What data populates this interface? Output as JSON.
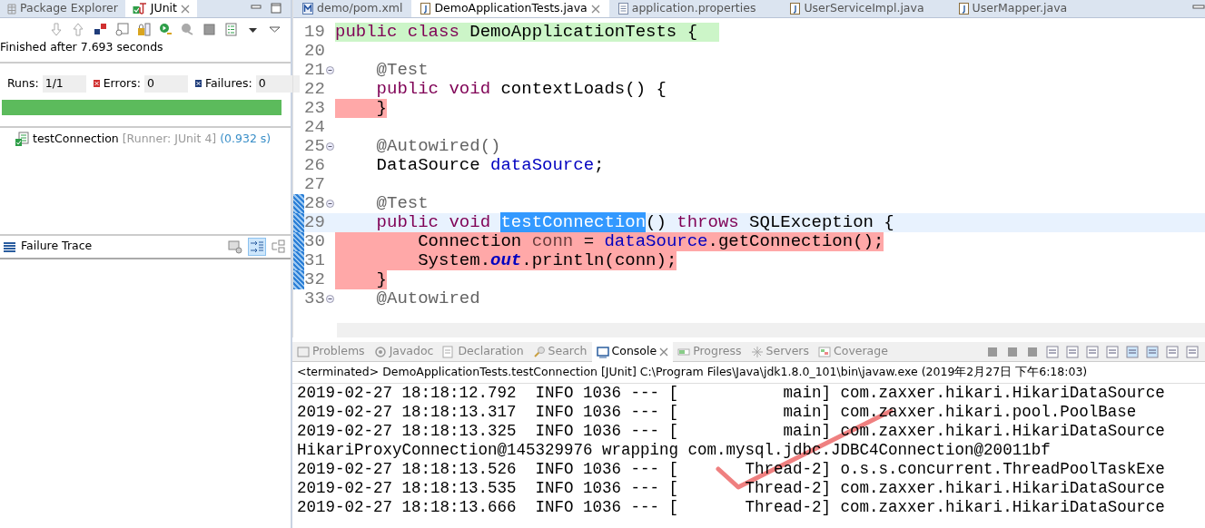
{
  "junit_view": {
    "tabs": [
      {
        "label": "Package Explorer",
        "selected": false,
        "kind": "explorer"
      },
      {
        "label": "JUnit",
        "selected": true,
        "kind": "junit"
      }
    ],
    "status": "Finished after 7.693 seconds",
    "counters": [
      {
        "label": "Runs:",
        "value": "1/1",
        "kind": "runs"
      },
      {
        "label": "Errors:",
        "value": "0",
        "kind": "errors"
      },
      {
        "label": "Failures:",
        "value": "0",
        "kind": "failures"
      }
    ],
    "progress": {
      "level": 1,
      "passed": true
    },
    "tests": [
      {
        "name": "testConnection",
        "runner": "[Runner: JUnit 4]",
        "time": "(0.932 s)",
        "passed": true
      }
    ],
    "failure_trace": {
      "title": "Failure Trace"
    }
  },
  "editor": {
    "tabs": [
      {
        "label": "demo/pom.xml",
        "selected": false,
        "kind": "xml"
      },
      {
        "label": "DemoApplicationTests.java",
        "selected": true,
        "kind": "java"
      },
      {
        "label": "application.properties",
        "selected": false,
        "kind": "text"
      },
      {
        "label": "UserServiceImpl.java",
        "selected": false,
        "kind": "java"
      },
      {
        "label": "UserMapper.java",
        "selected": false,
        "kind": "java"
      }
    ],
    "lines": [
      {
        "number": "19",
        "fold": false,
        "marked": false,
        "current": false,
        "color": "#ccf5c8",
        "tokens": [
          {
            "text": "public class",
            "kind": "keyword"
          },
          {
            "text": " DemoApplicationTests {",
            "kind": "plain"
          }
        ]
      },
      {
        "number": "20",
        "fold": false,
        "marked": false,
        "current": false
      },
      {
        "number": "21",
        "fold": true,
        "marked": false,
        "current": false,
        "tokens": [
          {
            "text": "\t@Test",
            "kind": "annotation"
          }
        ]
      },
      {
        "number": "22",
        "fold": false,
        "marked": false,
        "current": false,
        "tokens": [
          {
            "text": "\tpublic void",
            "kind": "keyword"
          },
          {
            "text": " contextLoads() {",
            "kind": "plain"
          }
        ]
      },
      {
        "number": "23",
        "fold": false,
        "marked": false,
        "current": false,
        "color": "#ffa8a8",
        "tokens": [
          {
            "text": "\t}",
            "kind": "plain"
          }
        ]
      },
      {
        "number": "24",
        "fold": false,
        "marked": false,
        "current": false
      },
      {
        "number": "25",
        "fold": true,
        "marked": false,
        "current": false,
        "tokens": [
          {
            "text": "\t@Autowired()",
            "kind": "annotation"
          }
        ]
      },
      {
        "number": "26",
        "fold": false,
        "marked": false,
        "current": false,
        "tokens": [
          {
            "text": "\tDataSource ",
            "kind": "plain"
          },
          {
            "text": "dataSource",
            "kind": "field"
          },
          {
            "text": ";",
            "kind": "plain"
          }
        ]
      },
      {
        "number": "27",
        "fold": false,
        "marked": false,
        "current": false
      },
      {
        "number": "28",
        "fold": true,
        "marked": true,
        "current": false,
        "tokens": [
          {
            "text": "\t@Test",
            "kind": "annotation"
          }
        ]
      },
      {
        "number": "29",
        "fold": false,
        "marked": true,
        "current": true,
        "tokens": [
          {
            "text": "\tpublic void ",
            "kind": "keyword"
          },
          {
            "text": "testConnection",
            "kind": "selection"
          },
          {
            "text": "() ",
            "kind": "plain"
          },
          {
            "text": "throws",
            "kind": "keyword"
          },
          {
            "text": " SQLException {",
            "kind": "plain"
          }
        ]
      },
      {
        "number": "30",
        "fold": false,
        "marked": true,
        "current": false,
        "color": "#ffa8a8",
        "tokens": [
          {
            "text": "\t\tConnection ",
            "kind": "plain"
          },
          {
            "text": "conn",
            "kind": "local"
          },
          {
            "text": " = ",
            "kind": "plain"
          },
          {
            "text": "dataSource",
            "kind": "field"
          },
          {
            "text": ".getConnection();",
            "kind": "plain"
          }
        ]
      },
      {
        "number": "31",
        "fold": false,
        "marked": true,
        "current": false,
        "color": "#ffa8a8",
        "tokens": [
          {
            "text": "\t\tSystem.",
            "kind": "plain"
          },
          {
            "text": "out",
            "kind": "static"
          },
          {
            "text": ".println(conn);",
            "kind": "plain"
          }
        ]
      },
      {
        "number": "32",
        "fold": false,
        "marked": true,
        "current": false,
        "color": "#ffa8a8",
        "tokens": [
          {
            "text": "\t}",
            "kind": "plain"
          }
        ]
      },
      {
        "number": "33",
        "fold": true,
        "marked": false,
        "current": false,
        "tokens": [
          {
            "text": "\t@Autowired",
            "kind": "annotation"
          }
        ]
      }
    ]
  },
  "bottom_panel": {
    "tabs": [
      {
        "label": "Problems",
        "selected": false,
        "kind": "problems"
      },
      {
        "label": "Javadoc",
        "selected": false,
        "kind": "javadoc"
      },
      {
        "label": "Declaration",
        "selected": false,
        "kind": "declaration"
      },
      {
        "label": "Search",
        "selected": false,
        "kind": "search"
      },
      {
        "label": "Console",
        "selected": true,
        "kind": "console"
      },
      {
        "label": "Progress",
        "selected": false,
        "kind": "progress"
      },
      {
        "label": "Servers",
        "selected": false,
        "kind": "servers"
      },
      {
        "label": "Coverage",
        "selected": false,
        "kind": "coverage"
      }
    ],
    "process": "<terminated> DemoApplicationTests.testConnection [JUnit] C:\\Program Files\\Java\\jdk1.8.0_101\\bin\\javaw.exe (2019年2月27日 下午6:18:03)",
    "output": [
      "2019-02-27 18:18:12.792  INFO 1036 --- [           main] com.zaxxer.hikari.HikariDataSource",
      "2019-02-27 18:18:13.317  INFO 1036 --- [           main] com.zaxxer.hikari.pool.PoolBase",
      "2019-02-27 18:18:13.325  INFO 1036 --- [           main] com.zaxxer.hikari.HikariDataSource",
      "HikariProxyConnection@145329976 wrapping com.mysql.jdbc.JDBC4Connection@20011bf",
      "2019-02-27 18:18:13.526  INFO 1036 --- [       Thread-2] o.s.s.concurrent.ThreadPoolTaskExe",
      "2019-02-27 18:18:13.535  INFO 1036 --- [       Thread-2] com.zaxxer.hikari.HikariDataSource",
      "2019-02-27 18:18:13.666  INFO 1036 --- [       Thread-2] com.zaxxer.hikari.HikariDataSource"
    ]
  }
}
